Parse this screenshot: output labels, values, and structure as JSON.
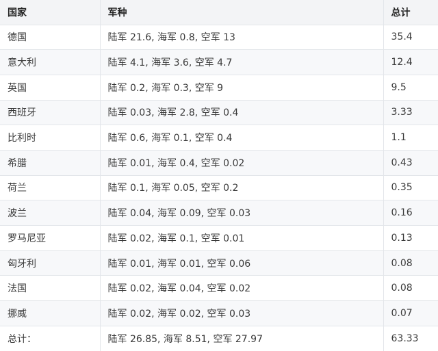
{
  "table": {
    "headers": [
      "国家",
      "军种",
      "总计"
    ],
    "rows": [
      {
        "country": "德国",
        "branches": "陆军 21.6, 海军 0.8, 空军 13",
        "total": "35.4"
      },
      {
        "country": "意大利",
        "branches": "陆军 4.1, 海军 3.6, 空军 4.7",
        "total": "12.4"
      },
      {
        "country": "英国",
        "branches": "陆军 0.2, 海军 0.3, 空军 9",
        "total": "9.5"
      },
      {
        "country": "西班牙",
        "branches": "陆军 0.03, 海军 2.8, 空军 0.4",
        "total": "3.33"
      },
      {
        "country": "比利时",
        "branches": "陆军 0.6, 海军 0.1, 空军 0.4",
        "total": "1.1"
      },
      {
        "country": "希腊",
        "branches": "陆军 0.01, 海军 0.4, 空军 0.02",
        "total": "0.43"
      },
      {
        "country": "荷兰",
        "branches": "陆军 0.1, 海军 0.05, 空军 0.2",
        "total": "0.35"
      },
      {
        "country": "波兰",
        "branches": "陆军 0.04, 海军 0.09, 空军 0.03",
        "total": "0.16"
      },
      {
        "country": "罗马尼亚",
        "branches": "陆军 0.02, 海军 0.1, 空军 0.01",
        "total": "0.13"
      },
      {
        "country": "匈牙利",
        "branches": "陆军 0.01, 海军 0.01, 空军 0.06",
        "total": "0.08"
      },
      {
        "country": "法国",
        "branches": "陆军 0.02, 海军 0.04, 空军 0.02",
        "total": "0.08"
      },
      {
        "country": "挪威",
        "branches": "陆军 0.02, 海军 0.02, 空军 0.03",
        "total": "0.07"
      }
    ],
    "footer": {
      "country": "总计：",
      "branches": "陆军 26.85, 海军 8.51, 空军 27.97",
      "total": "63.33"
    }
  }
}
